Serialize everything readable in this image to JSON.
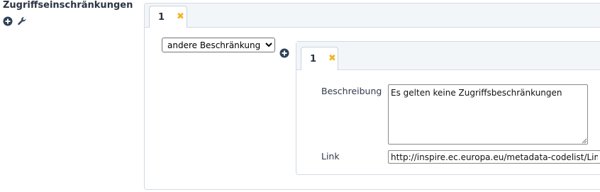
{
  "section": {
    "title": "Zugriffseinschränkungen",
    "icons": [
      "plus-circle-icon",
      "wrench-icon"
    ]
  },
  "outer_tabs": [
    {
      "label": "1",
      "close_icon": "close-x-icon"
    }
  ],
  "restriction_select": {
    "selected": "andere Beschränkungen"
  },
  "inner_tabs": [
    {
      "label": "1",
      "close_icon": "close-x-icon"
    }
  ],
  "fields": {
    "beschreibung_label": "Beschreibung",
    "beschreibung_value": "Es gelten keine Zugriffsbeschränkungen",
    "link_label": "Link",
    "link_value": "http://inspire.ec.europa.eu/metadata-codelist/LimitationsOnPublicAccess/noLimitations"
  },
  "colors": {
    "accent_icon": "#2e4257",
    "close_icon": "#f0b429",
    "tab_border": "#c7d4df"
  }
}
